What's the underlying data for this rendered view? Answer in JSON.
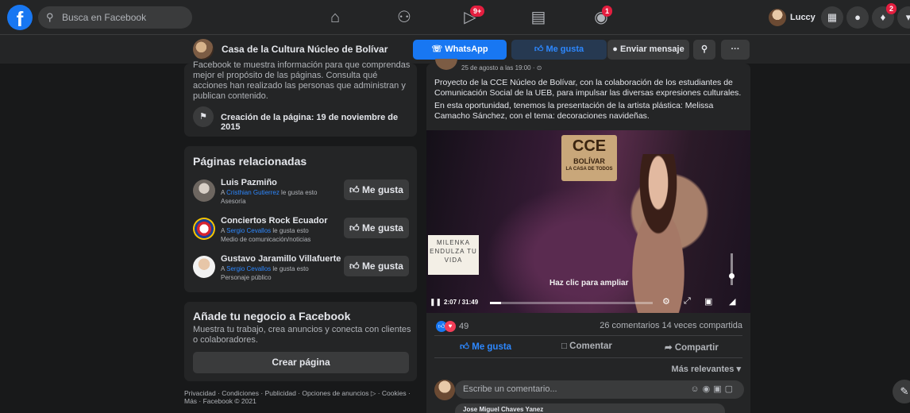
{
  "topnav": {
    "logo": "f",
    "search_placeholder": "Busca en Facebook",
    "icons": [
      "home-icon",
      "friends-icon",
      "watch-icon",
      "marketplace-icon",
      "groups-icon"
    ],
    "watch_badge": "9+",
    "groups_badge": "1",
    "user_name": "Luccy",
    "notifications_badge": "2"
  },
  "page_header": {
    "page_name": "Casa de la Cultura Núcleo de Bolívar",
    "whatsapp_label": "WhatsApp",
    "like_label": "Me gusta",
    "message_label": "Enviar mensaje",
    "more_label": "···"
  },
  "about": {
    "text": "Facebook te muestra información para que comprendas mejor el propósito de las páginas. Consulta qué acciones han realizado las personas que administran y publican contenido.",
    "created": "Creación de la página: 19 de noviembre de 2015"
  },
  "related": {
    "title": "Páginas relacionadas",
    "items": [
      {
        "name": "Luis Pazmiño",
        "prefix": "A ",
        "friend": "Cristhian Gutierrez",
        "suffix": " le gusta esto",
        "category": "Asesoría",
        "button": "Me gusta"
      },
      {
        "name": "Conciertos Rock Ecuador",
        "prefix": "A ",
        "friend": "Sergio Cevallos",
        "suffix": " le gusta esto",
        "category": "Medio de comunicación/noticias",
        "button": "Me gusta"
      },
      {
        "name": "Gustavo Jaramillo Villafuerte",
        "prefix": "A ",
        "friend": "Sergio Cevallos",
        "suffix": " le gusta esto",
        "category": "Personaje público",
        "button": "Me gusta"
      }
    ]
  },
  "business": {
    "title": "Añade tu negocio a Facebook",
    "description": "Muestra tu trabajo, crea anuncios y conecta con clientes o colaboradores.",
    "button": "Crear página"
  },
  "footer": {
    "line1": "Privacidad · Condiciones · Publicidad · Opciones de anuncios ▷ · Cookies ·",
    "line2": "Más · Facebook © 2021"
  },
  "post": {
    "date": "25 de agosto a las 19:00 · ⊙",
    "paragraph1": "Proyecto de la CCE Núcleo de Bolívar, con la colaboración de los estudiantes de Comunicación Social de la UEB,  para impulsar las diversas expresiones culturales.",
    "paragraph2": "En esta oportunidad, tenemos la presentación  de la artista plástica: Melissa Camacho Sánchez, con el tema: decoraciones navideñas.",
    "video": {
      "logo_main": "CCE",
      "logo_sub": "BOLÍVAR",
      "logo_caption": "LA CASA DE TODOS",
      "lightbox_text": "MILENKA ENDULZA TU VIDA",
      "hint": "Haz clic para ampliar",
      "time": "2:07 / 31:49",
      "progress_fraction": 0.067
    },
    "reaction_count": "49",
    "stats": "26 comentarios  14 veces compartida",
    "action_like": "Me gusta",
    "action_comment": "Comentar",
    "action_share": "Compartir",
    "sort_label": "Más relevantes ▾",
    "comment_placeholder": "Escribe un comentario...",
    "first_commenter": "Jose Miguel Chaves Yanez"
  },
  "colors": {
    "brand": "#1877f2",
    "background": "#18191a",
    "surface": "#242526",
    "badge": "#e41e3f"
  }
}
